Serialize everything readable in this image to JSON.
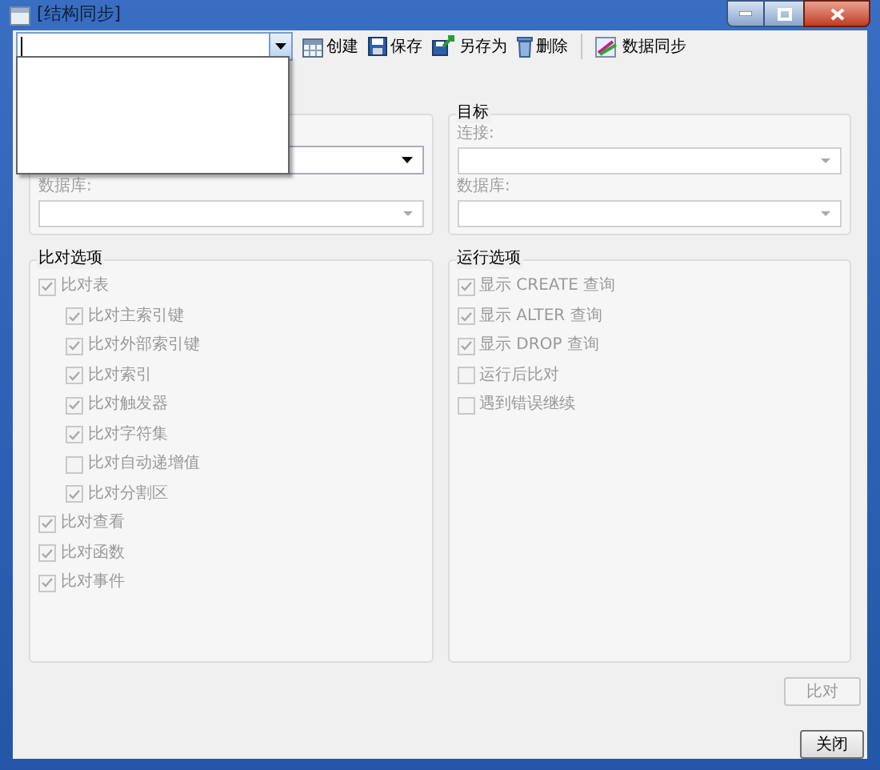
{
  "window": {
    "title": "[结构同步]"
  },
  "toolbar": {
    "connection_combo": {
      "expanded": true
    },
    "buttons": [
      {
        "label": "创建",
        "kind": "create"
      },
      {
        "label": "保存",
        "kind": "save"
      },
      {
        "label": "另存为",
        "kind": "saveas"
      },
      {
        "label": "删除",
        "kind": "delete"
      },
      {
        "label": "数据同步",
        "kind": "sync",
        "separator_before": true
      }
    ]
  },
  "source": {
    "database_label": "数据库:"
  },
  "target": {
    "title": "目标",
    "connection_label": "连接:",
    "database_label": "数据库:"
  },
  "compare_options": {
    "title": "比对选项",
    "items": [
      {
        "label": "比对表",
        "checked": true,
        "disabled": true,
        "children": [
          {
            "label": "比对主索引键",
            "checked": true,
            "disabled": true
          },
          {
            "label": "比对外部索引键",
            "checked": true,
            "disabled": true
          },
          {
            "label": "比对索引",
            "checked": true,
            "disabled": true
          },
          {
            "label": "比对触发器",
            "checked": true,
            "disabled": true
          },
          {
            "label": "比对字符集",
            "checked": true,
            "disabled": true
          },
          {
            "label": "比对自动递增值",
            "checked": false,
            "disabled": true
          },
          {
            "label": "比对分割区",
            "checked": true,
            "disabled": true
          }
        ]
      },
      {
        "label": "比对查看",
        "checked": true,
        "disabled": true
      },
      {
        "label": "比对函数",
        "checked": true,
        "disabled": true
      },
      {
        "label": "比对事件",
        "checked": true,
        "disabled": true
      }
    ]
  },
  "run_options": {
    "title": "运行选项",
    "items": [
      {
        "label": "显示 CREATE 查询",
        "checked": true,
        "disabled": true
      },
      {
        "label": "显示 ALTER 查询",
        "checked": true,
        "disabled": true
      },
      {
        "label": "显示 DROP 查询",
        "checked": true,
        "disabled": true
      },
      {
        "label": "运行后比对",
        "checked": false,
        "disabled": true
      },
      {
        "label": "遇到错误继续",
        "checked": false,
        "disabled": true
      }
    ]
  },
  "buttons": [
    {
      "label": "比对",
      "disabled": true
    },
    {
      "label": "关闭",
      "disabled": false
    }
  ]
}
